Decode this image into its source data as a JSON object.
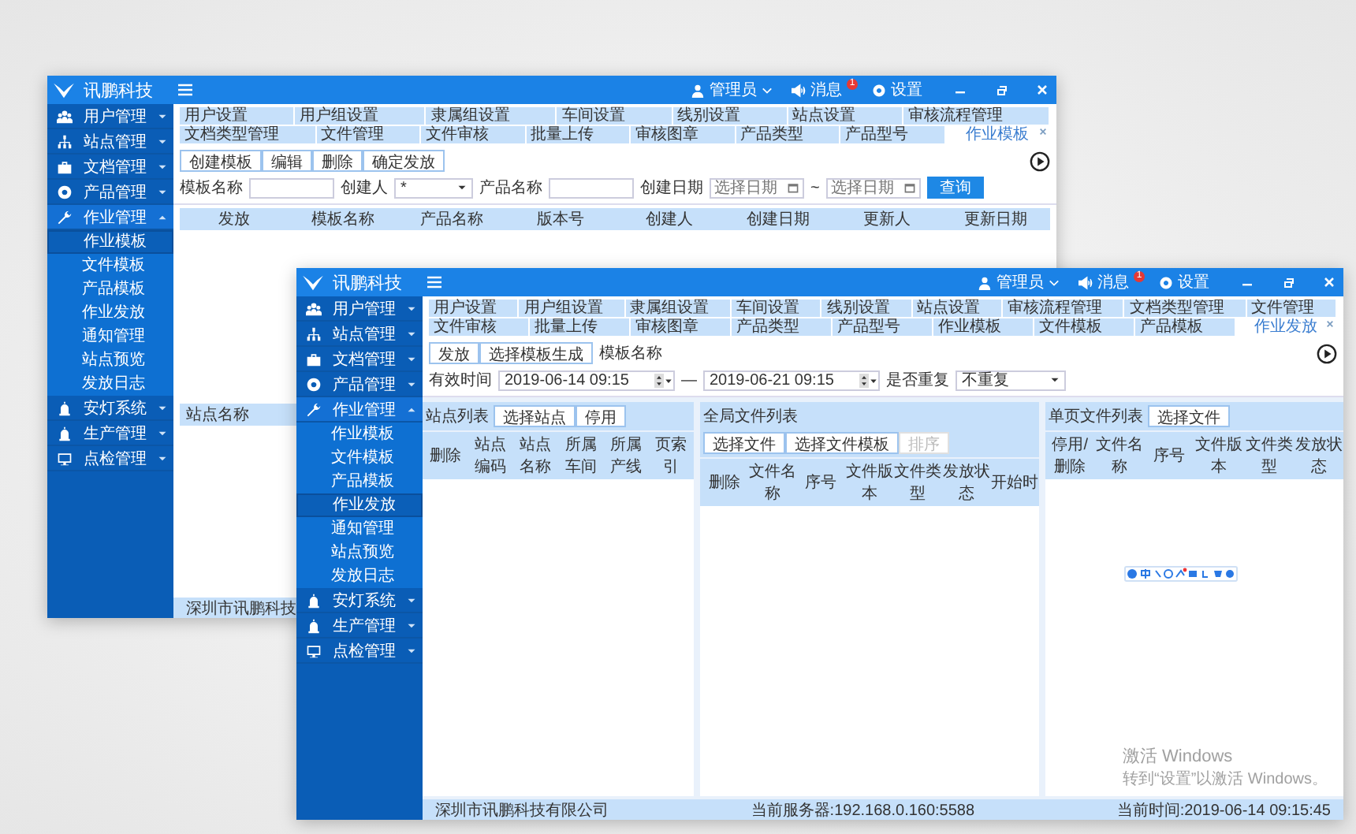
{
  "back_window": {
    "header": {
      "title": "讯鹏科技",
      "user": "管理员",
      "messages": "消息",
      "badge": "1",
      "settings": "设置"
    },
    "sidebar": [
      {
        "label": "用户管理",
        "expanded": false
      },
      {
        "label": "站点管理",
        "expanded": false
      },
      {
        "label": "文档管理",
        "expanded": false
      },
      {
        "label": "产品管理",
        "expanded": false
      },
      {
        "label": "作业管理",
        "expanded": true,
        "children": [
          {
            "label": "作业模板",
            "selected": true
          },
          {
            "label": "文件模板",
            "selected": false
          },
          {
            "label": "产品模板",
            "selected": false
          },
          {
            "label": "作业发放",
            "selected": false
          },
          {
            "label": "通知管理",
            "selected": false
          },
          {
            "label": "站点预览",
            "selected": false
          },
          {
            "label": "发放日志",
            "selected": false
          }
        ]
      },
      {
        "label": "安灯系统",
        "expanded": false
      },
      {
        "label": "生产管理",
        "expanded": false
      },
      {
        "label": "点检管理",
        "expanded": false
      }
    ],
    "tab_rows": [
      {
        "tabs": [
          {
            "label": "用户设置",
            "selected": false
          },
          {
            "label": "用户组设置",
            "selected": false
          },
          {
            "label": "隶属组设置",
            "selected": false
          },
          {
            "label": "车间设置",
            "selected": false
          },
          {
            "label": "线别设置",
            "selected": false
          },
          {
            "label": "站点设置",
            "selected": false
          },
          {
            "label": "审核流程管理",
            "selected": false
          }
        ]
      },
      {
        "tabs": [
          {
            "label": "文档类型管理",
            "selected": false
          },
          {
            "label": "文件管理",
            "selected": false
          },
          {
            "label": "文件审核",
            "selected": false
          },
          {
            "label": "批量上传",
            "selected": false
          },
          {
            "label": "审核图章",
            "selected": false
          },
          {
            "label": "产品类型",
            "selected": false
          },
          {
            "label": "产品型号",
            "selected": false
          },
          {
            "label": "作业模板",
            "selected": true
          }
        ]
      }
    ],
    "toolbar_buttons": [
      "创建模板",
      "编辑",
      "删除",
      "确定发放"
    ],
    "filters": [
      {
        "kind": "input",
        "label": "模板名称"
      },
      {
        "kind": "select",
        "label": "创建人",
        "value": "*"
      },
      {
        "kind": "input",
        "label": "产品名称"
      },
      {
        "kind": "date",
        "label": "创建日期",
        "placeholder": "选择日期"
      },
      {
        "kind": "date",
        "separator": "~",
        "placeholder": "选择日期"
      }
    ],
    "search_button": "查询",
    "table": {
      "columns": [
        "发放",
        "模板名称",
        "产品名称",
        "版本号",
        "创建人",
        "创建日期",
        "更新人",
        "更新日期"
      ]
    },
    "lower_panel": {
      "column": "站点名称"
    },
    "status_bar": {
      "company": "深圳市讯鹏科技"
    }
  },
  "front_window": {
    "header": {
      "title": "讯鹏科技",
      "user": "管理员",
      "messages": "消息",
      "badge": "1",
      "settings": "设置"
    },
    "sidebar": [
      {
        "label": "用户管理",
        "expanded": false
      },
      {
        "label": "站点管理",
        "expanded": false
      },
      {
        "label": "文档管理",
        "expanded": false
      },
      {
        "label": "产品管理",
        "expanded": false
      },
      {
        "label": "作业管理",
        "expanded": true,
        "children": [
          {
            "label": "作业模板",
            "selected": false
          },
          {
            "label": "文件模板",
            "selected": false
          },
          {
            "label": "产品模板",
            "selected": false
          },
          {
            "label": "作业发放",
            "selected": true
          },
          {
            "label": "通知管理",
            "selected": false
          },
          {
            "label": "站点预览",
            "selected": false
          },
          {
            "label": "发放日志",
            "selected": false
          }
        ]
      },
      {
        "label": "安灯系统",
        "expanded": false
      },
      {
        "label": "生产管理",
        "expanded": false
      },
      {
        "label": "点检管理",
        "expanded": false
      }
    ],
    "tab_rows": [
      {
        "tabs": [
          {
            "label": "用户设置",
            "selected": false
          },
          {
            "label": "用户组设置",
            "selected": false
          },
          {
            "label": "隶属组设置",
            "selected": false
          },
          {
            "label": "车间设置",
            "selected": false
          },
          {
            "label": "线别设置",
            "selected": false
          },
          {
            "label": "站点设置",
            "selected": false
          },
          {
            "label": "审核流程管理",
            "selected": false
          },
          {
            "label": "文档类型管理",
            "selected": false
          },
          {
            "label": "文件管理",
            "selected": false
          }
        ]
      },
      {
        "tabs": [
          {
            "label": "文件审核",
            "selected": false
          },
          {
            "label": "批量上传",
            "selected": false
          },
          {
            "label": "审核图章",
            "selected": false
          },
          {
            "label": "产品类型",
            "selected": false
          },
          {
            "label": "产品型号",
            "selected": false
          },
          {
            "label": "作业模板",
            "selected": false
          },
          {
            "label": "文件模板",
            "selected": false
          },
          {
            "label": "产品模板",
            "selected": false
          },
          {
            "label": "作业发放",
            "selected": true
          }
        ]
      }
    ],
    "toolbar_buttons": [
      "发放",
      "选择模板生成"
    ],
    "template_label": "模板名称",
    "time_row": {
      "label": "有效时间",
      "start": "2019-06-14 09:15",
      "separator": "—",
      "end": "2019-06-21 09:15",
      "repeat_label": "是否重复",
      "repeat_value": "不重复"
    },
    "panels": [
      {
        "title": "站点列表",
        "buttons": [
          {
            "label": "选择站点",
            "disabled": false
          },
          {
            "label": "停用",
            "disabled": false
          }
        ],
        "columns": [
          "删除",
          "站点编码",
          "站点名称",
          "所属车间",
          "所属产线",
          "页索引"
        ]
      },
      {
        "title": "全局文件列表",
        "buttons": [
          {
            "label": "选择文件",
            "disabled": false
          },
          {
            "label": "选择文件模板",
            "disabled": false
          },
          {
            "label": "排序",
            "disabled": true
          }
        ],
        "columns": [
          "删除",
          "文件名称",
          "序号",
          "文件版本",
          "文件类型",
          "发放状态",
          "开始时"
        ]
      },
      {
        "title": "单页文件列表",
        "buttons": [
          {
            "label": "选择文件",
            "disabled": false
          }
        ],
        "columns": [
          "停用/删除",
          "文件名称",
          "序号",
          "文件版本",
          "文件类型",
          "发放状态"
        ]
      }
    ],
    "windows_notice": {
      "title": "激活 Windows",
      "text": "转到“设置”以激活 Windows。"
    },
    "status_bar": {
      "company": "深圳市讯鹏科技有限公司",
      "server": "当前服务器:192.168.0.160:5588",
      "time": "当前时间:2019-06-14 09:15:45"
    }
  }
}
